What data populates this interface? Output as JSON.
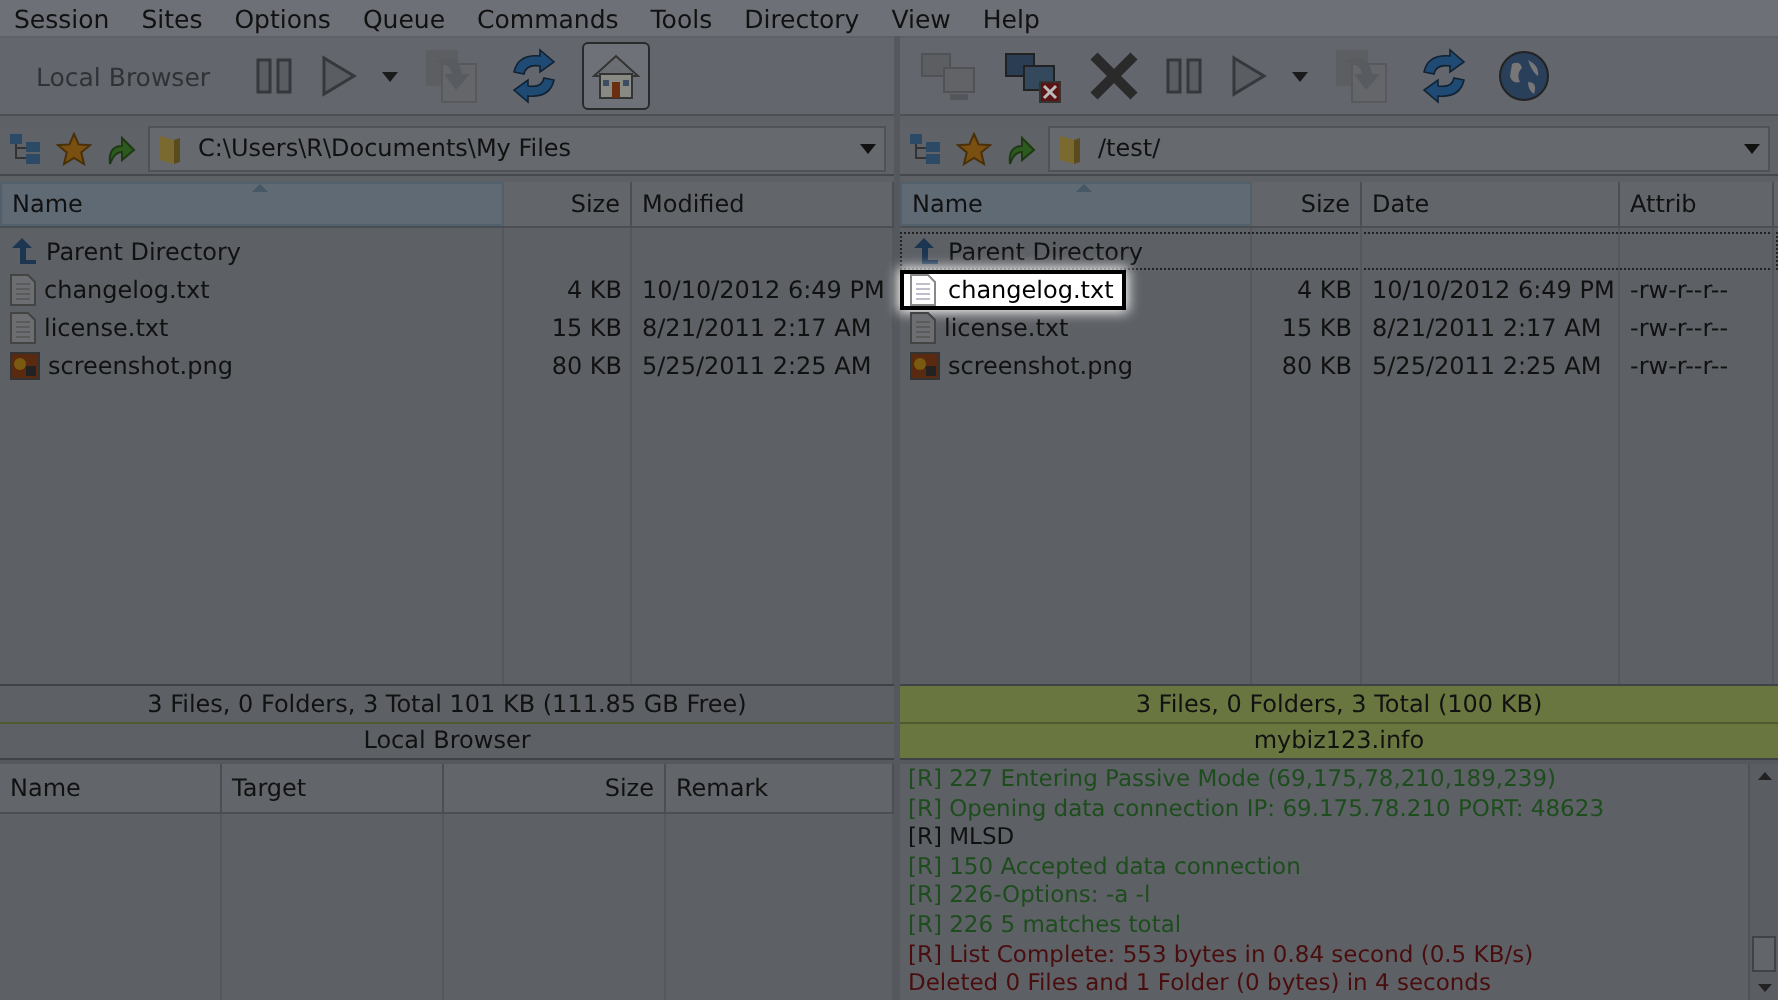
{
  "menu": [
    {
      "label": "Session"
    },
    {
      "label": "Sites"
    },
    {
      "label": "Options"
    },
    {
      "label": "Queue"
    },
    {
      "label": "Commands"
    },
    {
      "label": "Tools"
    },
    {
      "label": "Directory"
    },
    {
      "label": "View"
    },
    {
      "label": "Help"
    }
  ],
  "local": {
    "toolbar": [
      {
        "kind": "label",
        "label": "Local Browser",
        "disabled": true
      },
      {
        "kind": "pause",
        "disabled": true
      },
      {
        "kind": "play",
        "disabled": true
      },
      {
        "kind": "dropdown",
        "disabled": false
      },
      {
        "kind": "transfer",
        "disabled": true
      },
      {
        "kind": "refresh",
        "disabled": false
      },
      {
        "kind": "home",
        "disabled": false,
        "pressed": true
      }
    ],
    "path": "C:\\Users\\R\\Documents\\My Files",
    "columns": [
      {
        "label": "Name",
        "sorted": true
      },
      {
        "label": "Size",
        "sorted": false
      },
      {
        "label": "Modified",
        "sorted": false
      }
    ],
    "rows": [
      {
        "kind": "parent",
        "cells": [
          "Parent Directory",
          "",
          ""
        ],
        "focused": false,
        "highlighted": false
      },
      {
        "kind": "text",
        "cells": [
          "changelog.txt",
          "4 KB",
          "10/10/2012 6:49 PM"
        ],
        "focused": false,
        "highlighted": false
      },
      {
        "kind": "text",
        "cells": [
          "license.txt",
          "15 KB",
          "8/21/2011 2:17 AM"
        ],
        "focused": false,
        "highlighted": false
      },
      {
        "kind": "image",
        "cells": [
          "screenshot.png",
          "80 KB",
          "5/25/2011 2:25 AM"
        ],
        "focused": false,
        "highlighted": false
      }
    ],
    "status": "3 Files, 0 Folders, 3 Total 101 KB (111.85 GB Free)",
    "caption": "Local Browser",
    "connected": false
  },
  "remote": {
    "toolbar": [
      {
        "kind": "connect",
        "disabled": true
      },
      {
        "kind": "disconnect",
        "disabled": false
      },
      {
        "kind": "stop",
        "disabled": false
      },
      {
        "kind": "pause",
        "disabled": true
      },
      {
        "kind": "play",
        "disabled": true
      },
      {
        "kind": "dropdown",
        "disabled": false
      },
      {
        "kind": "transfer",
        "disabled": true
      },
      {
        "kind": "refresh",
        "disabled": false
      },
      {
        "kind": "globe",
        "disabled": false
      }
    ],
    "path": "/test/",
    "columns": [
      {
        "label": "Name",
        "sorted": true
      },
      {
        "label": "Size",
        "sorted": false
      },
      {
        "label": "Date",
        "sorted": false
      },
      {
        "label": "Attrib",
        "sorted": false
      }
    ],
    "rows": [
      {
        "kind": "parent",
        "cells": [
          "Parent Directory",
          "",
          "",
          ""
        ],
        "focused": true,
        "highlighted": false
      },
      {
        "kind": "text",
        "cells": [
          "changelog.txt",
          "4 KB",
          "10/10/2012 6:49 PM",
          "-rw-r--r--"
        ],
        "focused": false,
        "highlighted": true
      },
      {
        "kind": "text",
        "cells": [
          "license.txt",
          "15 KB",
          "8/21/2011 2:17 AM",
          "-rw-r--r--"
        ],
        "focused": false,
        "highlighted": false
      },
      {
        "kind": "image",
        "cells": [
          "screenshot.png",
          "80 KB",
          "5/25/2011 2:25 AM",
          "-rw-r--r--"
        ],
        "focused": false,
        "highlighted": false
      }
    ],
    "status": "3 Files, 0 Folders, 3 Total (100 KB)",
    "caption": "mybiz123.info",
    "connected": true
  },
  "queue": {
    "columns": [
      {
        "label": "Name"
      },
      {
        "label": "Target"
      },
      {
        "label": "Size"
      },
      {
        "label": "Remark"
      }
    ]
  },
  "log": [
    {
      "text": "[R] 227 Entering Passive Mode (69,175,78,210,189,239)",
      "color": "#1d4d1d"
    },
    {
      "text": "[R] Opening data connection IP: 69.175.78.210 PORT: 48623",
      "color": "#1d4d1d"
    },
    {
      "text": "[R] MLSD",
      "color": "#101010"
    },
    {
      "text": "[R] 150 Accepted data connection",
      "color": "#1d4d1d"
    },
    {
      "text": "[R] 226-Options: -a -l",
      "color": "#1d4d1d"
    },
    {
      "text": "[R] 226 5 matches total",
      "color": "#1d4d1d"
    },
    {
      "text": "[R] List Complete: 553 bytes in 0.84 second (0.5 KB/s)",
      "color": "#4a0d0d"
    },
    {
      "text": "Deleted 0 Files and 1 Folder (0 bytes) in 4 seconds",
      "color": "#4a0d0d"
    }
  ]
}
